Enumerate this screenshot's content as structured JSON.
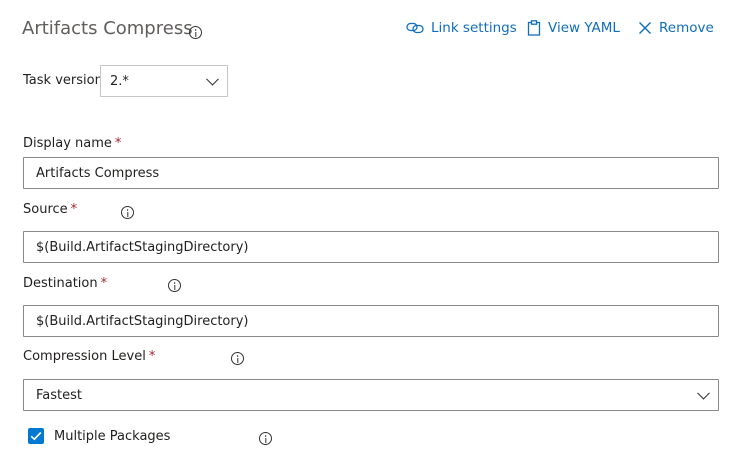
{
  "header": {
    "title": "Artifacts Compress",
    "link_settings_label": "Link settings",
    "view_yaml_label": "View YAML",
    "remove_label": "Remove"
  },
  "task_version": {
    "label": "Task version",
    "value": "2.*"
  },
  "fields": {
    "display_name": {
      "label": "Display name",
      "required_mark": "*",
      "value": "Artifacts Compress"
    },
    "source": {
      "label": "Source",
      "required_mark": "*",
      "value": "$(Build.ArtifactStagingDirectory)"
    },
    "destination": {
      "label": "Destination",
      "required_mark": "*",
      "value": "$(Build.ArtifactStagingDirectory)"
    },
    "compression_level": {
      "label": "Compression Level",
      "required_mark": "*",
      "value": "Fastest"
    },
    "multiple_packages": {
      "label": "Multiple Packages",
      "checked": true
    }
  },
  "colors": {
    "link": "#106ebe",
    "required": "#a4262c",
    "checkbox": "#0078d4"
  },
  "icons": [
    "info-icon",
    "link-icon",
    "clipboard-icon",
    "close-icon",
    "chevron-down-icon",
    "checkmark-icon"
  ]
}
